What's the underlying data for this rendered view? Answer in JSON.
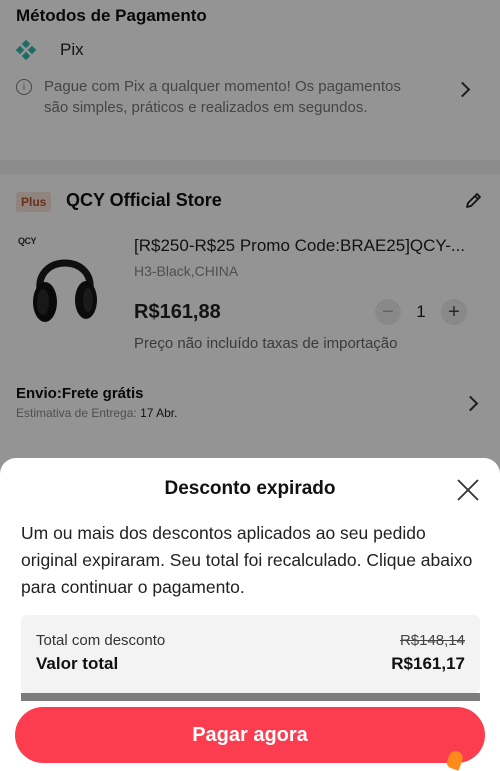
{
  "payment": {
    "title": "Métodos de Pagamento",
    "method": "Pix",
    "info": "Pague com Pix a qualquer momento! Os pagamentos são simples, práticos e realizados em segundos."
  },
  "store": {
    "badge": "Plus",
    "name": "QCY Official Store",
    "brand_logo": "QCY"
  },
  "product": {
    "title": "[R$250-R$25 Promo Code:BRAE25]QCY-...",
    "variant": "H3-Black,CHINA",
    "price": "R$161,88",
    "quantity": "1",
    "minus": "−",
    "plus": "+",
    "note": "Preço não incluído taxas de importação"
  },
  "shipping": {
    "title": "Envio:Frete grátis",
    "estimate_label": "Estimativa de Entrega:",
    "estimate_date": "17 Abr."
  },
  "dialog": {
    "title": "Desconto expirado",
    "message": "Um ou mais dos descontos aplicados ao seu pedido original expiraram. Seu total foi recalculado. Clique abaixo para continuar o pagamento.",
    "discount_label": "Total com desconto",
    "old_total": "R$148,14",
    "total_label": "Valor total",
    "total_value": "R$161,17",
    "button": "Pagar agora"
  },
  "colors": {
    "accent": "#fc3d50",
    "pix": "#32bcad",
    "plus_badge_bg": "#f6e3da",
    "plus_badge_text": "#b4542e"
  }
}
